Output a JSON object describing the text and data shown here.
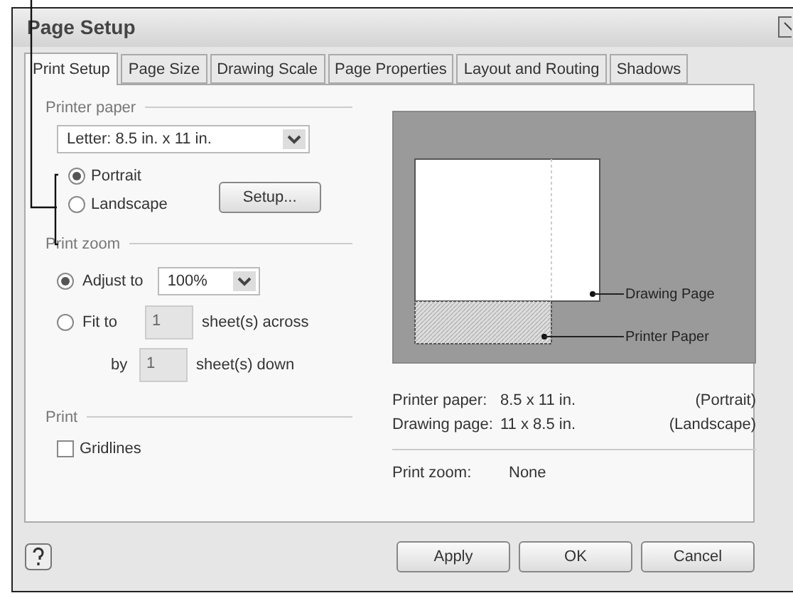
{
  "window": {
    "title": "Page Setup"
  },
  "tabs": [
    {
      "label": "Print Setup",
      "selected": true
    },
    {
      "label": "Page Size",
      "selected": false
    },
    {
      "label": "Drawing Scale",
      "selected": false
    },
    {
      "label": "Page Properties",
      "selected": false
    },
    {
      "label": "Layout and Routing",
      "selected": false
    },
    {
      "label": "Shadows",
      "selected": false
    }
  ],
  "printer_paper": {
    "heading": "Printer paper",
    "paper_size": "Letter:  8.5 in. x 11 in.",
    "orientations": [
      {
        "label": "Portrait",
        "selected": true
      },
      {
        "label": "Landscape",
        "selected": false
      }
    ],
    "setup_button": "Setup..."
  },
  "print_zoom": {
    "heading": "Print zoom",
    "options": [
      {
        "kind": "adjust",
        "label": "Adjust to",
        "selected": true,
        "value": "100%"
      },
      {
        "kind": "fit",
        "label": "Fit to",
        "selected": false,
        "across": "1",
        "across_label": "sheet(s) across",
        "by_label": "by",
        "down": "1",
        "down_label": "sheet(s) down"
      }
    ]
  },
  "print": {
    "heading": "Print",
    "options": [
      {
        "label": "Gridlines",
        "checked": false
      }
    ]
  },
  "preview": {
    "drawing_page_label": "Drawing Page",
    "printer_paper_label": "Printer Paper",
    "info": [
      {
        "label": "Printer paper:",
        "value": "8.5 x 11 in.",
        "orientation": "(Portrait)"
      },
      {
        "label": "Drawing page:",
        "value": "11 x 8.5 in.",
        "orientation": "(Landscape)"
      }
    ],
    "print_zoom": {
      "label": "Print zoom:",
      "value": "None"
    }
  },
  "buttons": [
    {
      "label": "Apply"
    },
    {
      "label": "OK"
    },
    {
      "label": "Cancel"
    }
  ]
}
